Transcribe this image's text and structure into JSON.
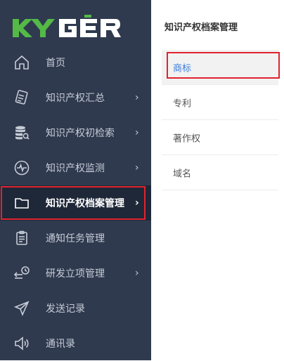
{
  "brand": {
    "logo_text": "KYGER",
    "logo_colors": {
      "ky": "#54b947",
      "ger": "#ffffff"
    }
  },
  "sidebar": {
    "items": [
      {
        "label": "首页",
        "icon": "home-icon",
        "has_arrow": false
      },
      {
        "label": "知识产权汇总",
        "icon": "document-pen-icon",
        "has_arrow": true
      },
      {
        "label": "知识产权初检索",
        "icon": "database-search-icon",
        "has_arrow": true
      },
      {
        "label": "知识产权监测",
        "icon": "pulse-monitor-icon",
        "has_arrow": true
      },
      {
        "label": "知识产权档案管理",
        "icon": "folder-icon",
        "has_arrow": true,
        "active": true
      },
      {
        "label": "通知任务管理",
        "icon": "clipboard-icon",
        "has_arrow": false
      },
      {
        "label": "研发立项管理",
        "icon": "schedule-icon",
        "has_arrow": true
      },
      {
        "label": "发送记录",
        "icon": "send-icon",
        "has_arrow": false
      },
      {
        "label": "通讯录",
        "icon": "speaker-icon",
        "has_arrow": false
      }
    ],
    "arrow": "›"
  },
  "panel": {
    "title": "知识产权档案管理",
    "items": [
      {
        "label": "商标",
        "selected": true
      },
      {
        "label": "专利"
      },
      {
        "label": "著作权"
      },
      {
        "label": "域名"
      }
    ]
  },
  "colors": {
    "sidebar_bg": "#2f3a4f",
    "active_bg": "#1f2838",
    "highlight_border": "#e0232e",
    "selected_text": "#3b7ddd"
  }
}
